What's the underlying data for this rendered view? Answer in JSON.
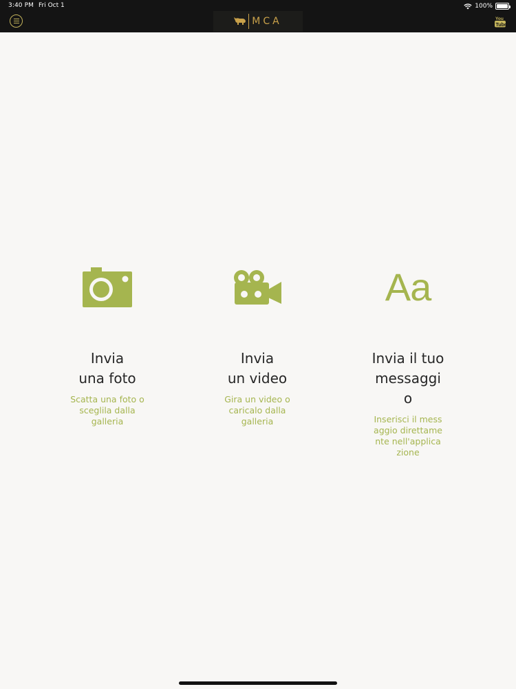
{
  "status_bar": {
    "time": "3:40 PM",
    "date": "Fri Oct 1",
    "battery": "100%",
    "battery_level": 1.0
  },
  "header": {
    "brand": "MCA",
    "icons": [
      "menu-icon",
      "bull-logo-icon",
      "youtube-icon"
    ],
    "accent_color": "#c9a14a"
  },
  "options": [
    {
      "icon": "camera-icon",
      "title_line1": "Invia",
      "title_line2": "una foto",
      "subtitle": "Scatta una foto o sceglila dalla galleria"
    },
    {
      "icon": "video-camera-icon",
      "title_line1": "Invia",
      "title_line2": "un video",
      "subtitle": "Gira un video o caricalo dalla galleria"
    },
    {
      "icon": "text-icon",
      "icon_text": "Aa",
      "title": "Invia il tuo messaggio",
      "subtitle": "Inserisci il messaggio direttamente nell'applicazione"
    }
  ],
  "colors": {
    "background": "#f8f7f5",
    "topbar": "#141414",
    "accent_green": "#a5b54f",
    "title_text": "#262626"
  }
}
